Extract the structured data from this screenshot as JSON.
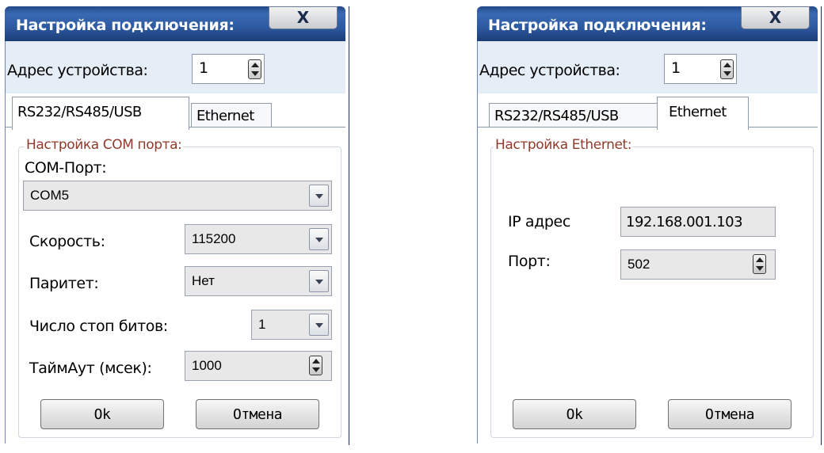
{
  "dialog_left": {
    "title": "Настройка подключения:",
    "close_label": "X",
    "address_label": "Адрес устройства:",
    "address_value": "1",
    "tabs": [
      {
        "label": "RS232/RS485/USB",
        "active": true
      },
      {
        "label": "Ethernet",
        "active": false
      }
    ],
    "group_title": "Настройка COM порта:",
    "com_port_label": "COM-Порт:",
    "com_port_value": "COM5",
    "speed_label": "Скорость:",
    "speed_value": "115200",
    "parity_label": "Паритет:",
    "parity_value": "Нет",
    "stop_bits_label": "Число стоп битов:",
    "stop_bits_value": "1",
    "timeout_label": "ТаймАут (мсек):",
    "timeout_value": "1000",
    "ok_label": "Ok",
    "cancel_label": "Отмена"
  },
  "dialog_right": {
    "title": "Настройка подключения:",
    "close_label": "X",
    "address_label": "Адрес устройства:",
    "address_value": "1",
    "tabs": [
      {
        "label": "RS232/RS485/USB",
        "active": false
      },
      {
        "label": "Ethernet",
        "active": true
      }
    ],
    "group_title": "Настройка Ethernet:",
    "ip_label": "IP адрес",
    "ip_value": "192.168.001.103",
    "port_label": "Порт:",
    "port_value": "502",
    "ok_label": "Ok",
    "cancel_label": "Отмена"
  }
}
